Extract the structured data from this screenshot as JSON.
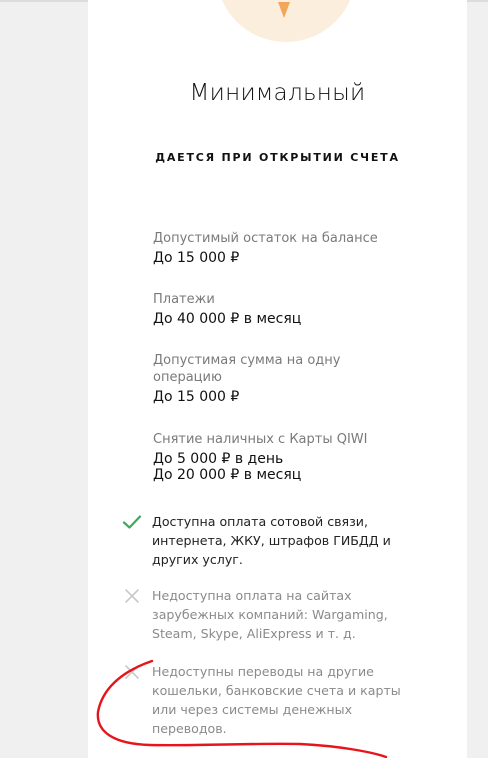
{
  "tariff": {
    "title": "Минимальный",
    "subtitle": "ДАЕТСЯ ПРИ ОТКРЫТИИ СЧЕТА"
  },
  "limits": [
    {
      "label_lines": [
        "Допустимый остаток на балансе"
      ],
      "value_lines": [
        "До 15 000 ₽"
      ]
    },
    {
      "label_lines": [
        "Платежи"
      ],
      "value_lines": [
        "До 40 000 ₽ в месяц"
      ]
    },
    {
      "label_lines": [
        "Допустимая сумма на одну",
        "операцию"
      ],
      "value_lines": [
        "До 15 000 ₽"
      ]
    },
    {
      "label_lines": [
        "Снятие наличных с Карты QIWI"
      ],
      "value_lines": [
        "До 5 000 ₽ в день",
        "До 20 000 ₽ в месяц"
      ]
    }
  ],
  "features": [
    {
      "available": true,
      "icon": "check-icon",
      "lines": [
        "Доступна оплата сотовой связи,",
        "интернета, ЖКУ, штрафов ГИБДД и",
        "других услуг."
      ]
    },
    {
      "available": false,
      "icon": "cross-icon",
      "lines": [
        "Недоступна оплата на сайтах",
        "зарубежных компаний: Wargaming,",
        "Steam, Skype, AliExpress и т. д."
      ]
    },
    {
      "available": false,
      "icon": "cross-icon",
      "lines": [
        "Недоступны переводы на другие",
        "кошельки, банковские счета и карты",
        "или через системы денежных",
        "переводов."
      ]
    }
  ],
  "colors": {
    "check": "#3aaa5c",
    "cross": "#c8c8c8",
    "annotation": "#e8141b",
    "avatar": "#fbeedd"
  }
}
